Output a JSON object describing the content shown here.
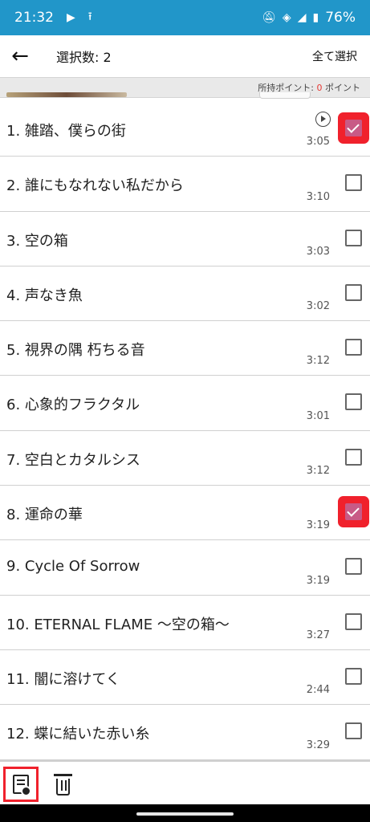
{
  "status_bar": {
    "time": "21:32",
    "left_icons": [
      "play-icon",
      "upload-icon"
    ],
    "right_icons": [
      "bell-off-icon",
      "wifi-icon",
      "signal-icon",
      "battery-icon"
    ],
    "battery": "76%"
  },
  "app_bar": {
    "title": "選択数: 2",
    "select_all": "全て選択"
  },
  "points": {
    "label": "所持ポイント: ",
    "value": "0",
    "unit": " ポイント"
  },
  "tracks": [
    {
      "title": "1. 雑踏、僕らの街",
      "duration": "3:05",
      "checked": true,
      "playing": true
    },
    {
      "title": "2. 誰にもなれない私だから",
      "duration": "3:10",
      "checked": false,
      "playing": false
    },
    {
      "title": "3. 空の箱",
      "duration": "3:03",
      "checked": false,
      "playing": false
    },
    {
      "title": "4. 声なき魚",
      "duration": "3:02",
      "checked": false,
      "playing": false
    },
    {
      "title": "5. 視界の隅 朽ちる音",
      "duration": "3:12",
      "checked": false,
      "playing": false
    },
    {
      "title": "6. 心象的フラクタル",
      "duration": "3:01",
      "checked": false,
      "playing": false
    },
    {
      "title": "7. 空白とカタルシス",
      "duration": "3:12",
      "checked": false,
      "playing": false
    },
    {
      "title": "8. 運命の華",
      "duration": "3:19",
      "checked": true,
      "playing": false
    },
    {
      "title": "9. Cycle Of Sorrow",
      "duration": "3:19",
      "checked": false,
      "playing": false
    },
    {
      "title": "10. ETERNAL FLAME 〜空の箱〜",
      "duration": "3:27",
      "checked": false,
      "playing": false
    },
    {
      "title": "11. 闇に溶けてく",
      "duration": "2:44",
      "checked": false,
      "playing": false
    },
    {
      "title": "12. 蝶に結いた赤い糸",
      "duration": "3:29",
      "checked": false,
      "playing": false
    }
  ],
  "toolbar": {
    "items": [
      "document-search-icon",
      "trash-icon"
    ]
  },
  "colors": {
    "status_bar": "#2196c9",
    "checked_fill": "#c85a86",
    "highlight": "#f0212c",
    "points_value": "#e53935"
  }
}
